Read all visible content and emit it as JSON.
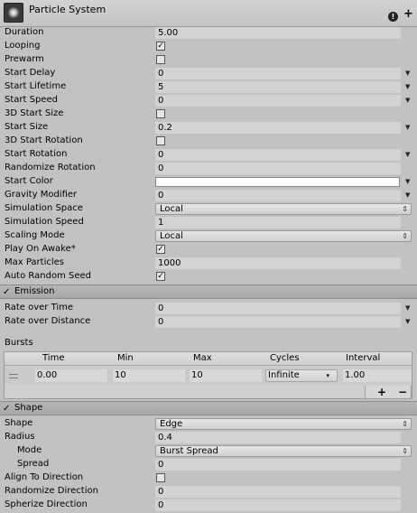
{
  "header": {
    "title": "Particle System",
    "help_icon": "help-icon",
    "add_icon": "plus-icon"
  },
  "main_rows": [
    {
      "label": "Duration",
      "type": "text",
      "value": "5.00"
    },
    {
      "label": "Looping",
      "type": "check",
      "checked": true
    },
    {
      "label": "Prewarm",
      "type": "check",
      "checked": false
    },
    {
      "label": "Start Delay",
      "type": "field",
      "value": "0"
    },
    {
      "label": "Start Lifetime",
      "type": "field",
      "value": "5"
    },
    {
      "label": "Start Speed",
      "type": "field",
      "value": "0"
    },
    {
      "label": "3D Start Size",
      "type": "check",
      "checked": false
    },
    {
      "label": "Start Size",
      "type": "field",
      "value": "0.2"
    },
    {
      "label": "3D Start Rotation",
      "type": "check",
      "checked": false
    },
    {
      "label": "Start Rotation",
      "type": "field",
      "value": "0"
    },
    {
      "label": "Randomize Rotation",
      "type": "text",
      "value": "0"
    },
    {
      "label": "Start Color",
      "type": "color",
      "value": "#ffffff"
    },
    {
      "label": "Gravity Modifier",
      "type": "field",
      "value": "0"
    },
    {
      "label": "Simulation Space",
      "type": "popup",
      "value": "Local"
    },
    {
      "label": "Simulation Speed",
      "type": "text",
      "value": "1"
    },
    {
      "label": "Scaling Mode",
      "type": "popup",
      "value": "Local"
    },
    {
      "label": "Play On Awake*",
      "type": "check",
      "checked": true
    },
    {
      "label": "Max Particles",
      "type": "text",
      "value": "1000"
    },
    {
      "label": "Auto Random Seed",
      "type": "check",
      "checked": true
    }
  ],
  "emission": {
    "title": "Emission",
    "enabled": true,
    "rows": [
      {
        "label": "Rate over Time",
        "type": "field",
        "value": "0"
      },
      {
        "label": "Rate over Distance",
        "type": "field",
        "value": "0"
      }
    ],
    "bursts_label": "Bursts",
    "bursts_columns": [
      "Time",
      "Min",
      "Max",
      "Cycles",
      "Interval"
    ],
    "bursts_rows": [
      {
        "time": "0.00",
        "min": "10",
        "max": "10",
        "cycles": "Infinite",
        "interval": "1.00"
      }
    ],
    "add_label": "+",
    "remove_label": "−"
  },
  "shape": {
    "title": "Shape",
    "enabled": true,
    "rows": [
      {
        "label": "Shape",
        "type": "popup",
        "value": "Edge"
      },
      {
        "label": "Radius",
        "type": "text",
        "value": "0.4"
      },
      {
        "label": "Mode",
        "type": "popup",
        "value": "Burst Spread",
        "indent": true
      },
      {
        "label": "Spread",
        "type": "text",
        "value": "0",
        "indent": true
      },
      {
        "label": "Align To Direction",
        "type": "check",
        "checked": false
      },
      {
        "label": "Randomize Direction",
        "type": "text",
        "value": "0"
      },
      {
        "label": "Spherize Direction",
        "type": "text",
        "value": "0"
      }
    ]
  },
  "glyphs": {
    "check": "✓",
    "popup_arrows": "⇕",
    "curve_arrow": "▼",
    "dropdown_arrow": "▾"
  }
}
